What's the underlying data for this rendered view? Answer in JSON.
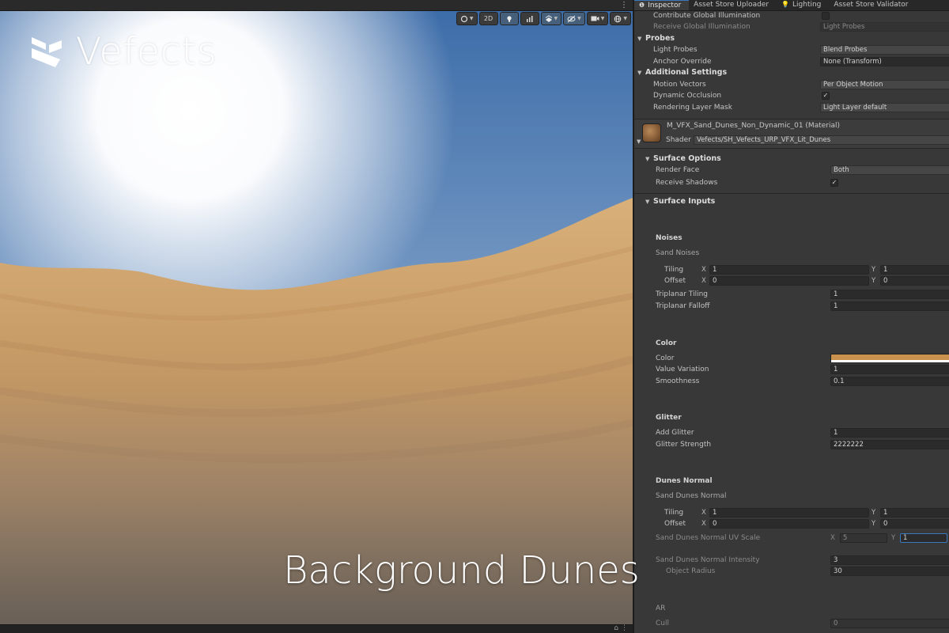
{
  "scene": {
    "toolbar": [
      {
        "name": "render-mode-button",
        "label": "",
        "icon": "render-mode-icon",
        "caret": "▼",
        "active": false
      },
      {
        "name": "2d-toggle-button",
        "label": "2D",
        "active": false
      },
      {
        "name": "lighting-toggle-button",
        "label": "",
        "icon": "light-icon",
        "active": true
      },
      {
        "name": "audio-toggle-button",
        "label": "",
        "icon": "audio-icon",
        "active": false
      },
      {
        "name": "effects-button",
        "label": "",
        "icon": "effects-icon",
        "caret": "▼",
        "active": true
      },
      {
        "name": "hidden-objects-button",
        "label": "",
        "icon": "visibility-icon",
        "caret": "▼",
        "active": true
      },
      {
        "name": "camera-button",
        "label": "",
        "icon": "camera-icon",
        "caret": "▼",
        "active": false
      },
      {
        "name": "gizmos-button",
        "label": "",
        "icon": "gizmos-icon",
        "caret": "▼",
        "active": false
      }
    ],
    "logo_text": "Vefects",
    "caption": "Background Dunes",
    "colors": {
      "sky_top": "#3f6fae",
      "sky_horizon": "#a9c2dc",
      "sun": "#ffffff",
      "sand_light": "#d6ac77",
      "sand_mid": "#b88a56",
      "sand_dark": "#8a6a4a"
    }
  },
  "inspector": {
    "tabs": [
      {
        "label": "Inspector",
        "icon": "info-icon",
        "active": true
      },
      {
        "label": "Asset Store Uploader",
        "active": false
      },
      {
        "label": "Lighting",
        "icon": "lightbulb-icon",
        "active": false
      },
      {
        "label": "Asset Store Validator",
        "active": false
      }
    ],
    "lighting": {
      "contribute_gi_label": "Contribute Global Illumination",
      "contribute_gi_checked": false,
      "receive_gi_label": "Receive Global Illumination",
      "receive_gi_value": "Light Probes"
    },
    "probes": {
      "header": "Probes",
      "light_probes_label": "Light Probes",
      "light_probes_value": "Blend Probes",
      "anchor_override_label": "Anchor Override",
      "anchor_override_value": "None (Transform)"
    },
    "additional": {
      "header": "Additional Settings",
      "motion_vectors_label": "Motion Vectors",
      "motion_vectors_value": "Per Object Motion",
      "dynamic_occlusion_label": "Dynamic Occlusion",
      "dynamic_occlusion_checked": "✓",
      "rendering_layer_label": "Rendering Layer Mask",
      "rendering_layer_value": "Light Layer default"
    },
    "material": {
      "name": "M_VFX_Sand_Dunes_Non_Dynamic_01 (Material)",
      "shader_label": "Shader",
      "shader_value": "Vefects/SH_Vefects_URP_VFX_Lit_Dunes"
    },
    "surface_options": {
      "header": "Surface Options",
      "render_face_label": "Render Face",
      "render_face_value": "Both",
      "receive_shadows_label": "Receive Shadows",
      "receive_shadows_checked": "✓"
    },
    "surface_inputs": {
      "header": "Surface Inputs"
    },
    "noises": {
      "title": "Noises",
      "sand_noises_label": "Sand Noises",
      "tiling_label": "Tiling",
      "tiling_x": "1",
      "tiling_y": "1",
      "offset_label": "Offset",
      "offset_x": "0",
      "offset_y": "0",
      "triplanar_tiling_label": "Triplanar Tiling",
      "triplanar_tiling_value": "1",
      "triplanar_falloff_label": "Triplanar Falloff",
      "triplanar_falloff_value": "1"
    },
    "color": {
      "title": "Color",
      "color_label": "Color",
      "color_value": "#c8924c",
      "value_variation_label": "Value Variation",
      "value_variation_value": "1",
      "smoothness_label": "Smoothness",
      "smoothness_value": "0.1"
    },
    "glitter": {
      "title": "Glitter",
      "add_glitter_label": "Add Glitter",
      "add_glitter_value": "1",
      "glitter_strength_label": "Glitter Strength",
      "glitter_strength_value": "2222222"
    },
    "dunes_normal": {
      "title": "Dunes Normal",
      "sand_dunes_normal_label": "Sand Dunes Normal",
      "tiling_label": "Tiling",
      "tiling_x": "1",
      "tiling_y": "1",
      "offset_label": "Offset",
      "offset_x": "0",
      "offset_y": "0",
      "uv_scale_label": "Sand Dunes Normal UV Scale",
      "uv_scale_x": "5",
      "uv_scale_y": "1",
      "intensity_label": "Sand Dunes Normal Intensity",
      "intensity_value": "3",
      "object_radius_label": "Object Radius",
      "object_radius_value": "30"
    },
    "ar": {
      "title": "AR",
      "cull_label": "Cull",
      "cull_value": "0"
    },
    "axis": {
      "x": "X",
      "y": "Y"
    }
  }
}
